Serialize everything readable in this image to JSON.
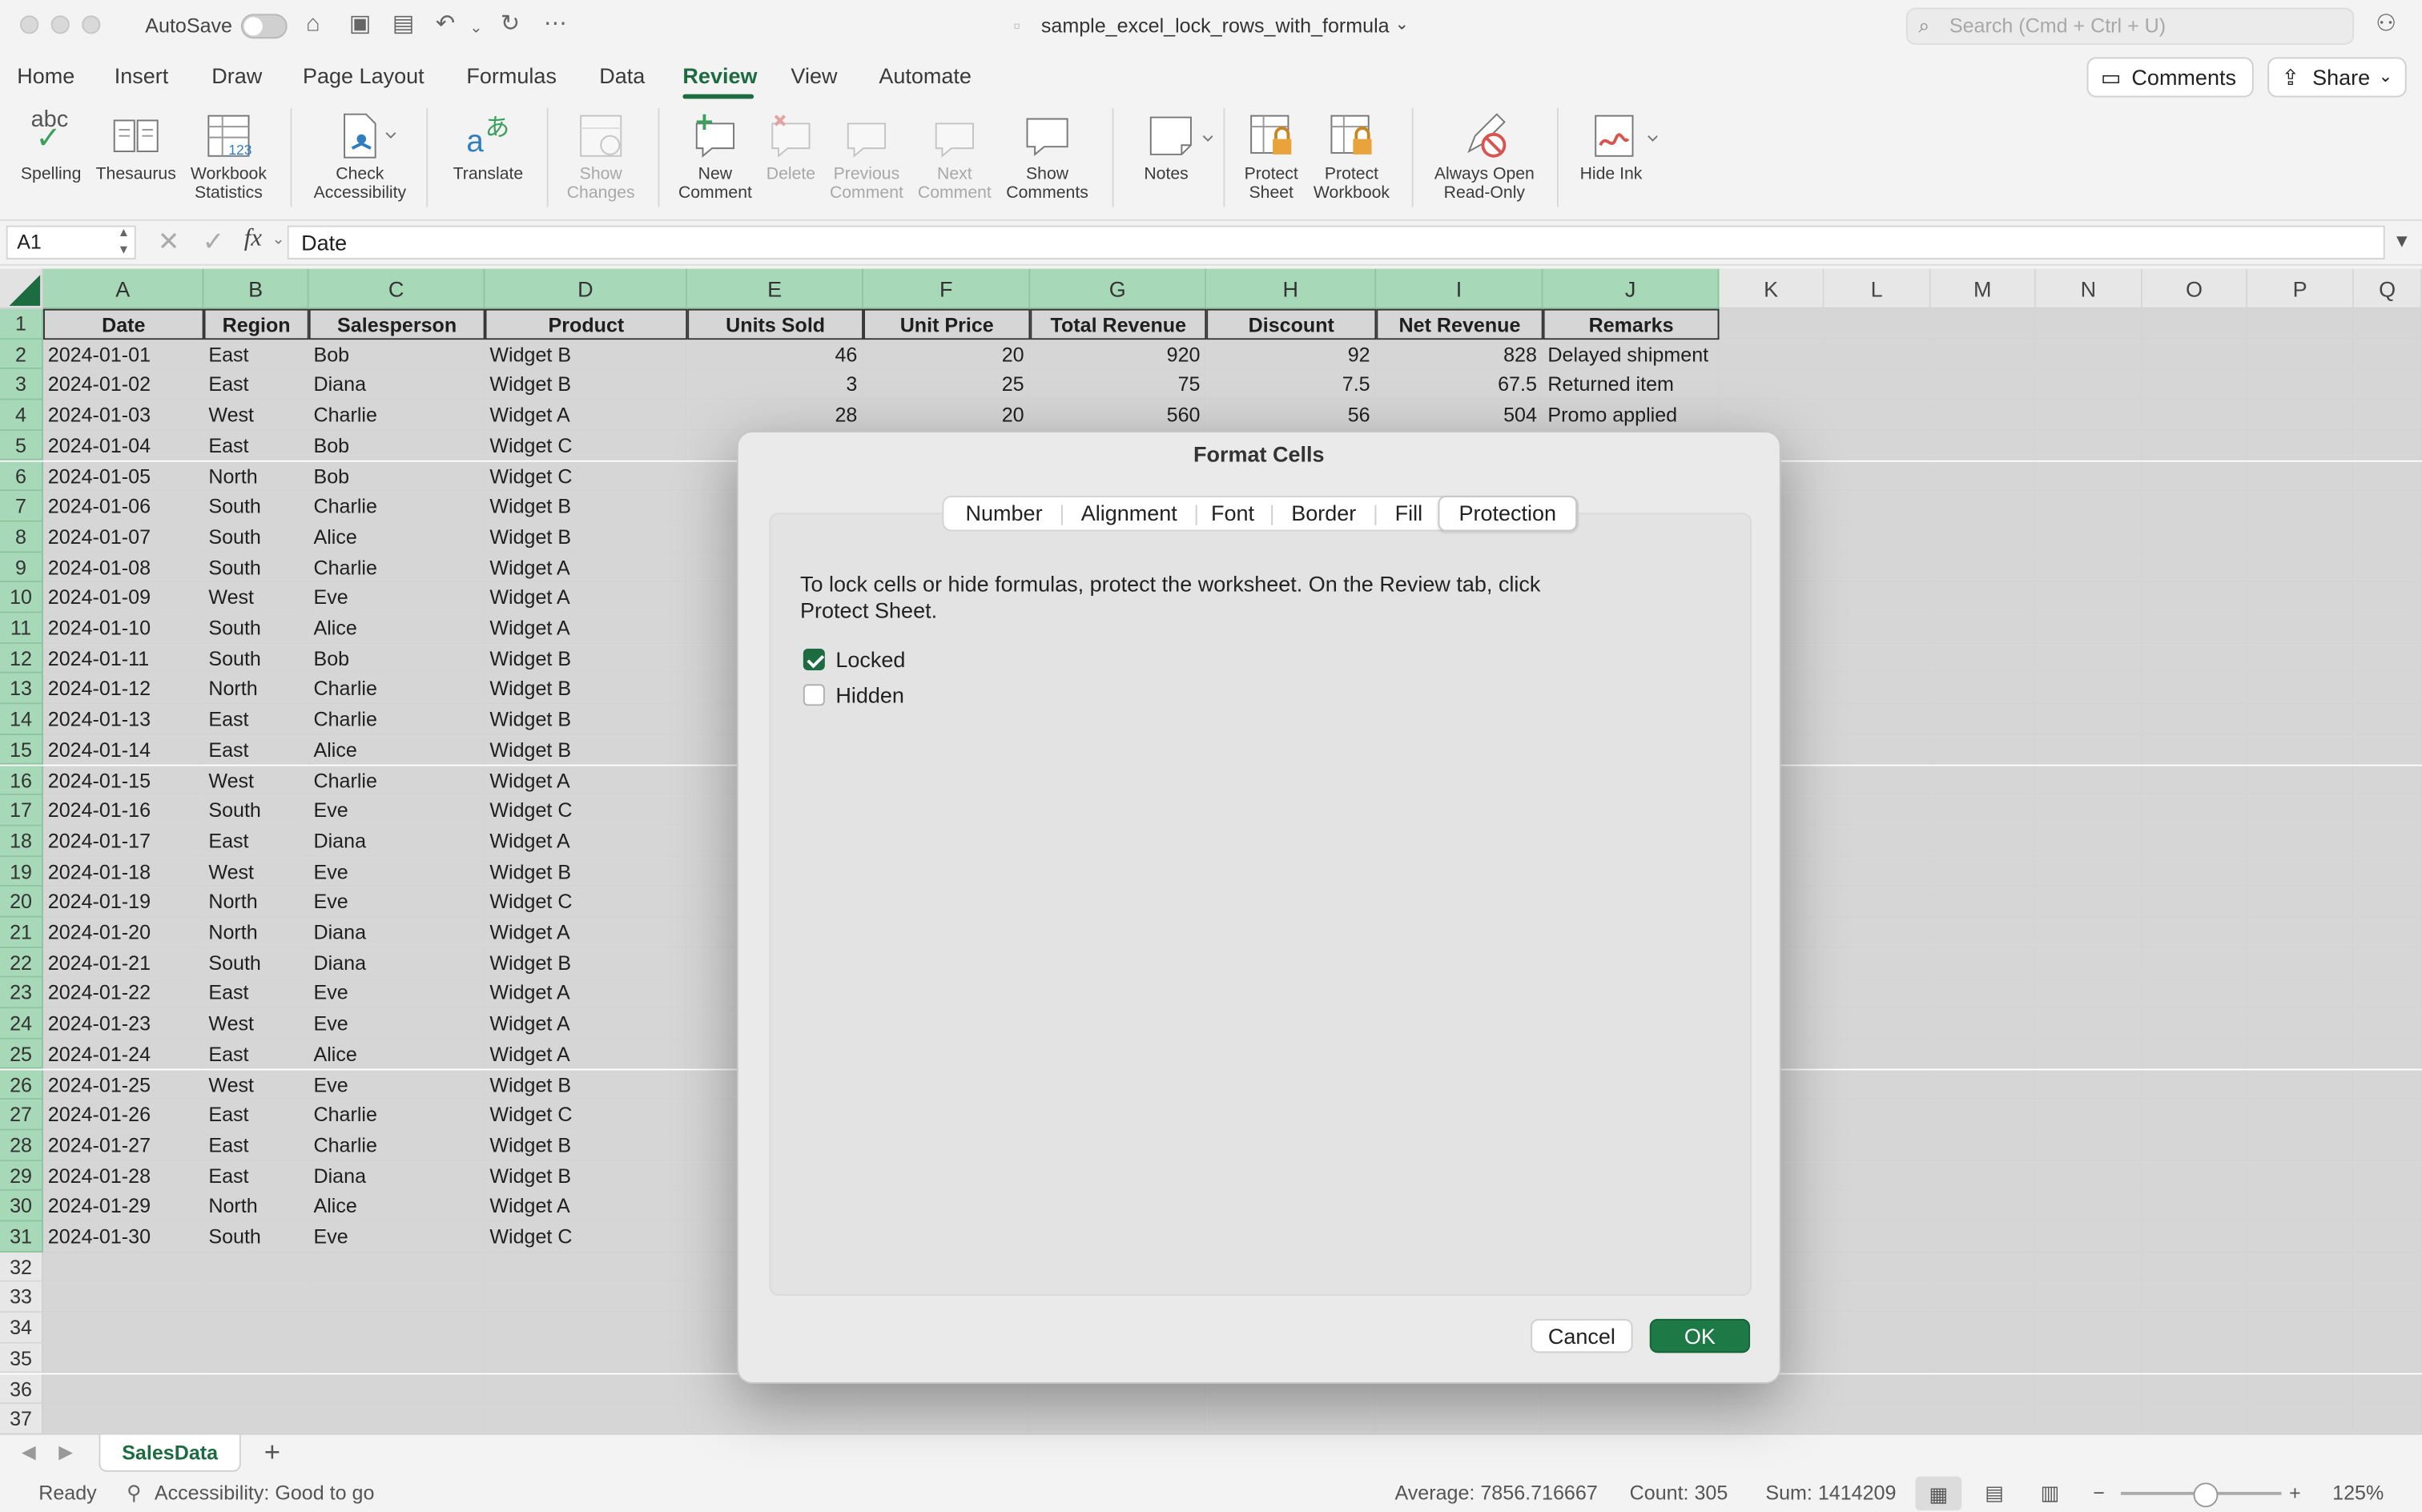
{
  "window": {
    "autosave_label": "AutoSave",
    "file_title": "sample_excel_lock_rows_with_formula",
    "search_placeholder": "Search (Cmd + Ctrl + U)"
  },
  "menu": {
    "tabs": [
      "Home",
      "Insert",
      "Draw",
      "Page Layout",
      "Formulas",
      "Data",
      "Review",
      "View",
      "Automate"
    ],
    "active": "Review",
    "comments_label": "Comments",
    "share_label": "Share"
  },
  "ribbon": {
    "spelling": "Spelling",
    "thesaurus": "Thesaurus",
    "workbook_statistics": [
      "Workbook",
      "Statistics"
    ],
    "check_accessibility": [
      "Check",
      "Accessibility"
    ],
    "translate": "Translate",
    "show_changes": [
      "Show",
      "Changes"
    ],
    "new_comment": [
      "New",
      "Comment"
    ],
    "delete": "Delete",
    "previous_comment": [
      "Previous",
      "Comment"
    ],
    "next_comment": [
      "Next",
      "Comment"
    ],
    "show_comments": [
      "Show",
      "Comments"
    ],
    "notes": "Notes",
    "protect_sheet": [
      "Protect",
      "Sheet"
    ],
    "protect_workbook": [
      "Protect",
      "Workbook"
    ],
    "always_open_readonly": [
      "Always Open",
      "Read-Only"
    ],
    "hide_ink": "Hide Ink",
    "abc_glyph": "abc"
  },
  "formula_bar": {
    "name_box": "A1",
    "fx": "fx",
    "value": "Date"
  },
  "columns": [
    "A",
    "B",
    "C",
    "D",
    "E",
    "F",
    "G",
    "H",
    "I",
    "J",
    "K",
    "L",
    "M",
    "N",
    "O",
    "P",
    "Q"
  ],
  "table": {
    "headers": [
      "Date",
      "Region",
      "Salesperson",
      "Product",
      "Units Sold",
      "Unit Price",
      "Total Revenue",
      "Discount",
      "Net Revenue",
      "Remarks"
    ],
    "rows": [
      [
        "2024-01-01",
        "East",
        "Bob",
        "Widget B",
        "46",
        "20",
        "920",
        "92",
        "828",
        "Delayed shipment"
      ],
      [
        "2024-01-02",
        "East",
        "Diana",
        "Widget B",
        "3",
        "25",
        "75",
        "7.5",
        "67.5",
        "Returned item"
      ],
      [
        "2024-01-03",
        "West",
        "Charlie",
        "Widget A",
        "28",
        "20",
        "560",
        "56",
        "504",
        "Promo applied"
      ],
      [
        "2024-01-04",
        "East",
        "Bob",
        "Widget C"
      ],
      [
        "2024-01-05",
        "North",
        "Bob",
        "Widget C"
      ],
      [
        "2024-01-06",
        "South",
        "Charlie",
        "Widget B"
      ],
      [
        "2024-01-07",
        "South",
        "Alice",
        "Widget B"
      ],
      [
        "2024-01-08",
        "South",
        "Charlie",
        "Widget A"
      ],
      [
        "2024-01-09",
        "West",
        "Eve",
        "Widget A"
      ],
      [
        "2024-01-10",
        "South",
        "Alice",
        "Widget A"
      ],
      [
        "2024-01-11",
        "South",
        "Bob",
        "Widget B"
      ],
      [
        "2024-01-12",
        "North",
        "Charlie",
        "Widget B"
      ],
      [
        "2024-01-13",
        "East",
        "Charlie",
        "Widget B"
      ],
      [
        "2024-01-14",
        "East",
        "Alice",
        "Widget B"
      ],
      [
        "2024-01-15",
        "West",
        "Charlie",
        "Widget A"
      ],
      [
        "2024-01-16",
        "South",
        "Eve",
        "Widget C"
      ],
      [
        "2024-01-17",
        "East",
        "Diana",
        "Widget A"
      ],
      [
        "2024-01-18",
        "West",
        "Eve",
        "Widget B"
      ],
      [
        "2024-01-19",
        "North",
        "Eve",
        "Widget C"
      ],
      [
        "2024-01-20",
        "North",
        "Diana",
        "Widget A"
      ],
      [
        "2024-01-21",
        "South",
        "Diana",
        "Widget B"
      ],
      [
        "2024-01-22",
        "East",
        "Eve",
        "Widget A"
      ],
      [
        "2024-01-23",
        "West",
        "Eve",
        "Widget A"
      ],
      [
        "2024-01-24",
        "East",
        "Alice",
        "Widget A"
      ],
      [
        "2024-01-25",
        "West",
        "Eve",
        "Widget B"
      ],
      [
        "2024-01-26",
        "East",
        "Charlie",
        "Widget C"
      ],
      [
        "2024-01-27",
        "East",
        "Charlie",
        "Widget B"
      ],
      [
        "2024-01-28",
        "East",
        "Diana",
        "Widget B"
      ],
      [
        "2024-01-29",
        "North",
        "Alice",
        "Widget A"
      ],
      [
        "2024-01-30",
        "South",
        "Eve",
        "Widget C"
      ]
    ],
    "row_numbers": [
      "1",
      "2",
      "3",
      "4",
      "5",
      "6",
      "7",
      "8",
      "9",
      "10",
      "11",
      "12",
      "13",
      "14",
      "15",
      "16",
      "17",
      "18",
      "19",
      "20",
      "21",
      "22",
      "23",
      "24",
      "25",
      "26",
      "27",
      "28",
      "29",
      "30",
      "31",
      "32",
      "33",
      "34",
      "35",
      "36",
      "37"
    ]
  },
  "sheet_tabs": {
    "active": "SalesData",
    "add": "+"
  },
  "status_bar": {
    "ready": "Ready",
    "accessibility": "Accessibility: Good to go",
    "average": "Average: 7856.716667",
    "count": "Count: 305",
    "sum": "Sum: 1414209",
    "zoom": "125%"
  },
  "dialog": {
    "title": "Format Cells",
    "tabs": [
      "Number",
      "Alignment",
      "Font",
      "Border",
      "Fill",
      "Protection"
    ],
    "active_tab": "Protection",
    "info": "To lock cells or hide formulas, protect the worksheet. On the Review tab, click Protect Sheet.",
    "locked_label": "Locked",
    "locked_checked": true,
    "hidden_label": "Hidden",
    "hidden_checked": false,
    "cancel_label": "Cancel",
    "ok_label": "OK"
  },
  "colors": {
    "accent": "#1d6b40",
    "header_green": "#a7d8b7",
    "ok_button": "#1d7a46"
  }
}
